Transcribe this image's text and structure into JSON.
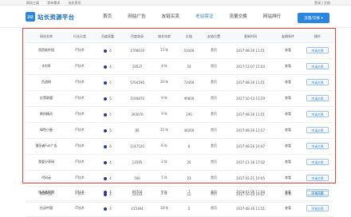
{
  "topbar": {
    "links": [
      "网站工具",
      "发布需求",
      "站长资讯"
    ],
    "right": "登录 | 注册"
  },
  "header": {
    "logo_badge": "ZIZ",
    "logo_text": "站长资源平台",
    "nav": [
      "首页",
      "网站广告",
      "友链买卖",
      "老站保证",
      "流量交换",
      "网站排行"
    ],
    "active_nav": 3,
    "cta": "流量/交换 ▾"
  },
  "table": {
    "columns": [
      "网站名称",
      "行业分类",
      "百度权重",
      "百度收录",
      "域名年龄",
      "反链",
      "友链位置",
      "更新时间",
      "友情条件",
      "操作"
    ],
    "rows": [
      {
        "name": "西西软件园",
        "cat": "IT技术",
        "br": "6",
        "idx": "1706619",
        "age": "13 年",
        "links": "51000",
        "pos": "首页",
        "time": "2017-08-16 11:51",
        "cond": "查看",
        "op": "申请交换"
      },
      {
        "name": "it大师",
        "cat": "IT技术",
        "br": "4",
        "idx": "33537",
        "age": "8 年",
        "links": "24",
        "pos": "首页",
        "time": "2017-12-07 15:04",
        "cond": "查看",
        "op": "申请交换"
      },
      {
        "name": "百战网",
        "cat": "IT技术",
        "br": "5",
        "idx": "5704196",
        "age": "20 年",
        "links": "72400",
        "pos": "首页",
        "time": "2017-08-16 11:51",
        "cond": "查看",
        "op": "申请交换"
      },
      {
        "name": "红黑联盟",
        "cat": "IT技术",
        "br": "5",
        "idx": "1190876",
        "age": "9 年",
        "links": "96800",
        "pos": "首页",
        "time": "2017-10-13 11:29",
        "cond": "查看",
        "op": "申请交换"
      },
      {
        "name": "刷机精灵",
        "cat": "IT技术",
        "br": "5",
        "idx": "393076",
        "age": "9 年",
        "links": "295",
        "pos": "首页",
        "time": "2017-08-16 11:51",
        "cond": "查看",
        "op": "申请交换"
      },
      {
        "name": "绿色小屋",
        "cat": "IT技术",
        "br": "5",
        "idx": "85",
        "age": "15 年",
        "links": "48200",
        "pos": "首页",
        "time": "2017-08-16 11:57",
        "cond": "查看",
        "op": "申请交换"
      },
      {
        "name": "落伍者Fun广告",
        "cat": "IT技术",
        "br": "6",
        "idx": "1147520",
        "age": "6 年",
        "links": "6",
        "pos": "首页",
        "time": "2017-08-26 10:47",
        "cond": "查看",
        "op": "申请交换"
      },
      {
        "name": "我爱分享网",
        "cat": "IT技术",
        "br": "4",
        "idx": "13595",
        "age": "2 年",
        "links": "25",
        "pos": "首页",
        "time": "2017-11-18 17:32",
        "cond": "查看",
        "op": "申请交换"
      },
      {
        "name": "代码云",
        "cat": "IT技术",
        "br": "4",
        "idx": "506",
        "age": "5 年",
        "links": "23",
        "pos": "首页",
        "time": "2017-02-21 10:05",
        "cond": "查看",
        "op": "申请交换"
      },
      {
        "name": "帮帮社区",
        "cat": "IT技术",
        "br": "4",
        "idx": "14433",
        "age": "2 年",
        "links": "12",
        "pos": "首页",
        "time": "2017-10-10 19:07",
        "cond": "查看",
        "op": "申请交换"
      }
    ],
    "below_rows": [
      {
        "name": "技术者联盟",
        "cat": "IT技术",
        "br": "4",
        "idx": "89704",
        "age": "9 年",
        "links": "7",
        "pos": "首页",
        "time": "2018-01-06 11:04",
        "cond": "查看",
        "op": "申请交换"
      },
      {
        "name": "红动中国",
        "cat": "IT技术",
        "br": "4",
        "idx": "215384",
        "age": "18 年",
        "links": "2",
        "pos": "首页",
        "time": "2017-08-16 11:51",
        "cond": "查看",
        "op": "申请交换"
      }
    ]
  },
  "colors": {
    "accent": "#2b86e0",
    "highlight_border": "#e8413b"
  }
}
